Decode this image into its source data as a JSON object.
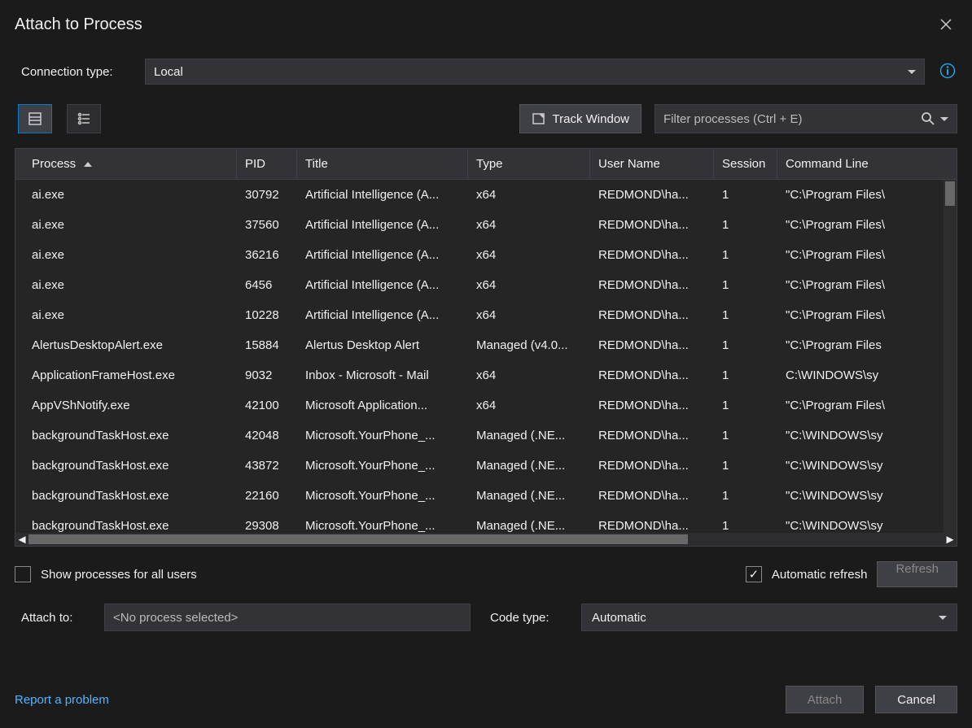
{
  "title": "Attach to Process",
  "connection": {
    "label": "Connection type:",
    "value": "Local"
  },
  "toolbar": {
    "track_window": "Track Window",
    "filter_placeholder": "Filter processes (Ctrl + E)"
  },
  "columns": {
    "process": "Process",
    "pid": "PID",
    "title": "Title",
    "type": "Type",
    "user": "User Name",
    "session": "Session",
    "cmd": "Command Line"
  },
  "rows": [
    {
      "process": "ai.exe",
      "pid": "30792",
      "title": "Artificial Intelligence (A...",
      "type": "x64",
      "user": "REDMOND\\ha...",
      "session": "1",
      "cmd": "\"C:\\Program Files\\"
    },
    {
      "process": "ai.exe",
      "pid": "37560",
      "title": "Artificial Intelligence (A...",
      "type": "x64",
      "user": "REDMOND\\ha...",
      "session": "1",
      "cmd": "\"C:\\Program Files\\"
    },
    {
      "process": "ai.exe",
      "pid": "36216",
      "title": "Artificial Intelligence (A...",
      "type": "x64",
      "user": "REDMOND\\ha...",
      "session": "1",
      "cmd": "\"C:\\Program Files\\"
    },
    {
      "process": "ai.exe",
      "pid": "6456",
      "title": "Artificial Intelligence (A...",
      "type": "x64",
      "user": "REDMOND\\ha...",
      "session": "1",
      "cmd": "\"C:\\Program Files\\"
    },
    {
      "process": "ai.exe",
      "pid": "10228",
      "title": "Artificial Intelligence (A...",
      "type": "x64",
      "user": "REDMOND\\ha...",
      "session": "1",
      "cmd": "\"C:\\Program Files\\"
    },
    {
      "process": "AlertusDesktopAlert.exe",
      "pid": "15884",
      "title": "Alertus Desktop Alert",
      "type": "Managed (v4.0...",
      "user": "REDMOND\\ha...",
      "session": "1",
      "cmd": "\"C:\\Program Files"
    },
    {
      "process": "ApplicationFrameHost.exe",
      "pid": "9032",
      "title": "Inbox - Microsoft - Mail",
      "type": "x64",
      "user": "REDMOND\\ha...",
      "session": "1",
      "cmd": "C:\\WINDOWS\\sy"
    },
    {
      "process": "AppVShNotify.exe",
      "pid": "42100",
      "title": "Microsoft Application...",
      "type": "x64",
      "user": "REDMOND\\ha...",
      "session": "1",
      "cmd": "\"C:\\Program Files\\"
    },
    {
      "process": "backgroundTaskHost.exe",
      "pid": "42048",
      "title": "Microsoft.YourPhone_...",
      "type": "Managed (.NE...",
      "user": "REDMOND\\ha...",
      "session": "1",
      "cmd": "\"C:\\WINDOWS\\sy"
    },
    {
      "process": "backgroundTaskHost.exe",
      "pid": "43872",
      "title": "Microsoft.YourPhone_...",
      "type": "Managed (.NE...",
      "user": "REDMOND\\ha...",
      "session": "1",
      "cmd": "\"C:\\WINDOWS\\sy"
    },
    {
      "process": "backgroundTaskHost.exe",
      "pid": "22160",
      "title": "Microsoft.YourPhone_...",
      "type": "Managed (.NE...",
      "user": "REDMOND\\ha...",
      "session": "1",
      "cmd": "\"C:\\WINDOWS\\sy"
    },
    {
      "process": "backgroundTaskHost.exe",
      "pid": "29308",
      "title": "Microsoft.YourPhone_...",
      "type": "Managed (.NE...",
      "user": "REDMOND\\ha...",
      "session": "1",
      "cmd": "\"C:\\WINDOWS\\sy"
    }
  ],
  "options": {
    "show_all_users": "Show processes for all users",
    "auto_refresh": "Automatic refresh",
    "refresh": "Refresh"
  },
  "attach": {
    "label": "Attach to:",
    "value": "<No process selected>",
    "codetype_label": "Code type:",
    "codetype_value": "Automatic"
  },
  "footer": {
    "report": "Report a problem",
    "attach": "Attach",
    "cancel": "Cancel"
  }
}
